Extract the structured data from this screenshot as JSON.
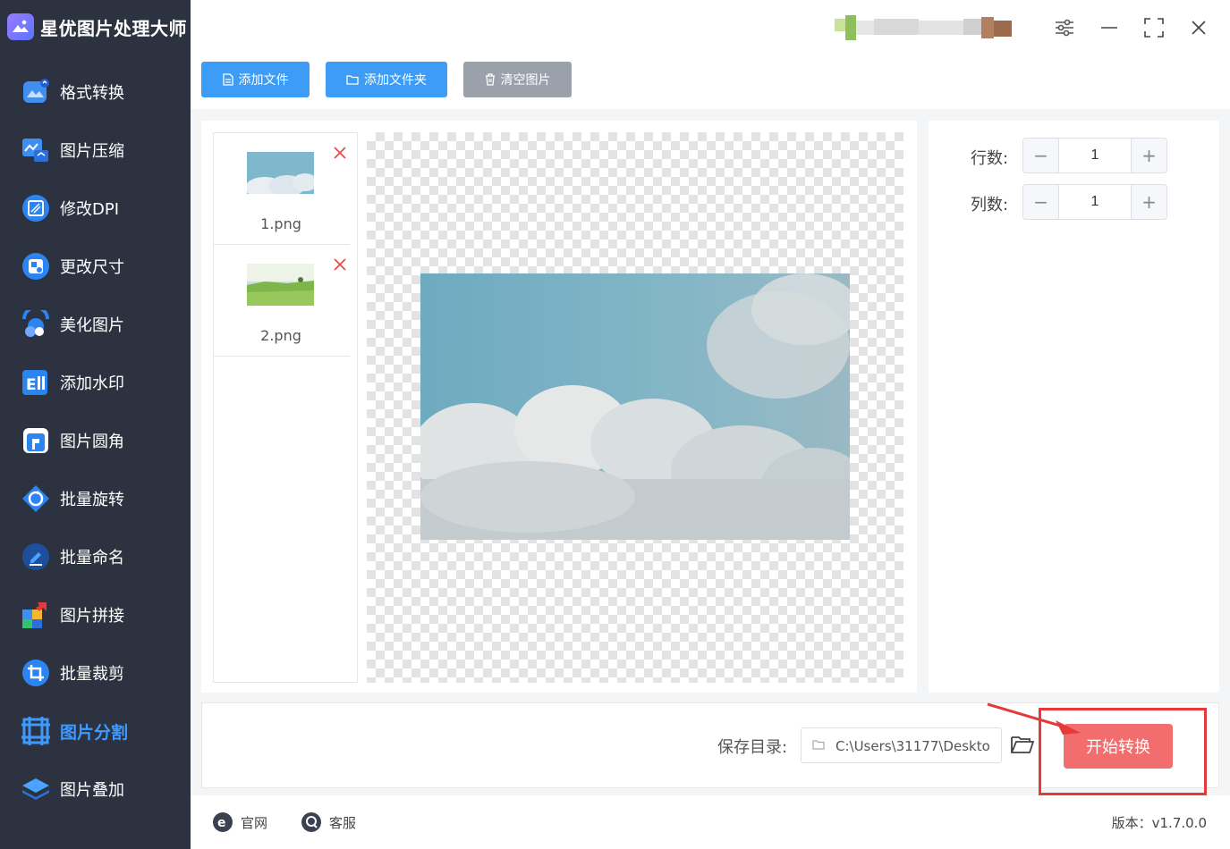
{
  "app": {
    "title": "星优图片处理大师"
  },
  "sidebar": {
    "items": [
      {
        "label": "格式转换",
        "icon": "format-convert-icon"
      },
      {
        "label": "图片压缩",
        "icon": "compress-icon"
      },
      {
        "label": "修改DPI",
        "icon": "dpi-icon"
      },
      {
        "label": "更改尺寸",
        "icon": "resize-icon"
      },
      {
        "label": "美化图片",
        "icon": "beautify-icon"
      },
      {
        "label": "添加水印",
        "icon": "watermark-icon"
      },
      {
        "label": "图片圆角",
        "icon": "round-corner-icon"
      },
      {
        "label": "批量旋转",
        "icon": "rotate-icon"
      },
      {
        "label": "批量命名",
        "icon": "rename-icon"
      },
      {
        "label": "图片拼接",
        "icon": "stitch-icon"
      },
      {
        "label": "批量裁剪",
        "icon": "crop-icon"
      },
      {
        "label": "图片分割",
        "icon": "split-icon",
        "active": true
      },
      {
        "label": "图片叠加",
        "icon": "overlay-icon"
      }
    ]
  },
  "toolbar": {
    "add_file": "添加文件",
    "add_folder": "添加文件夹",
    "clear": "清空图片"
  },
  "files": [
    {
      "name": "1.png"
    },
    {
      "name": "2.png"
    }
  ],
  "settings": {
    "rows_label": "行数:",
    "rows_value": "1",
    "cols_label": "列数:",
    "cols_value": "1"
  },
  "bottom": {
    "save_label": "保存目录:",
    "save_path": "C:\\Users\\31177\\Deskto",
    "start_label": "开始转换"
  },
  "footer": {
    "website": "官网",
    "support": "客服",
    "version": "版本：v1.7.0.0"
  },
  "colors": {
    "sidebar_bg": "#2d3240",
    "primary": "#3d9cf5",
    "start": "#f26d6d",
    "highlight": "#e8393a"
  }
}
